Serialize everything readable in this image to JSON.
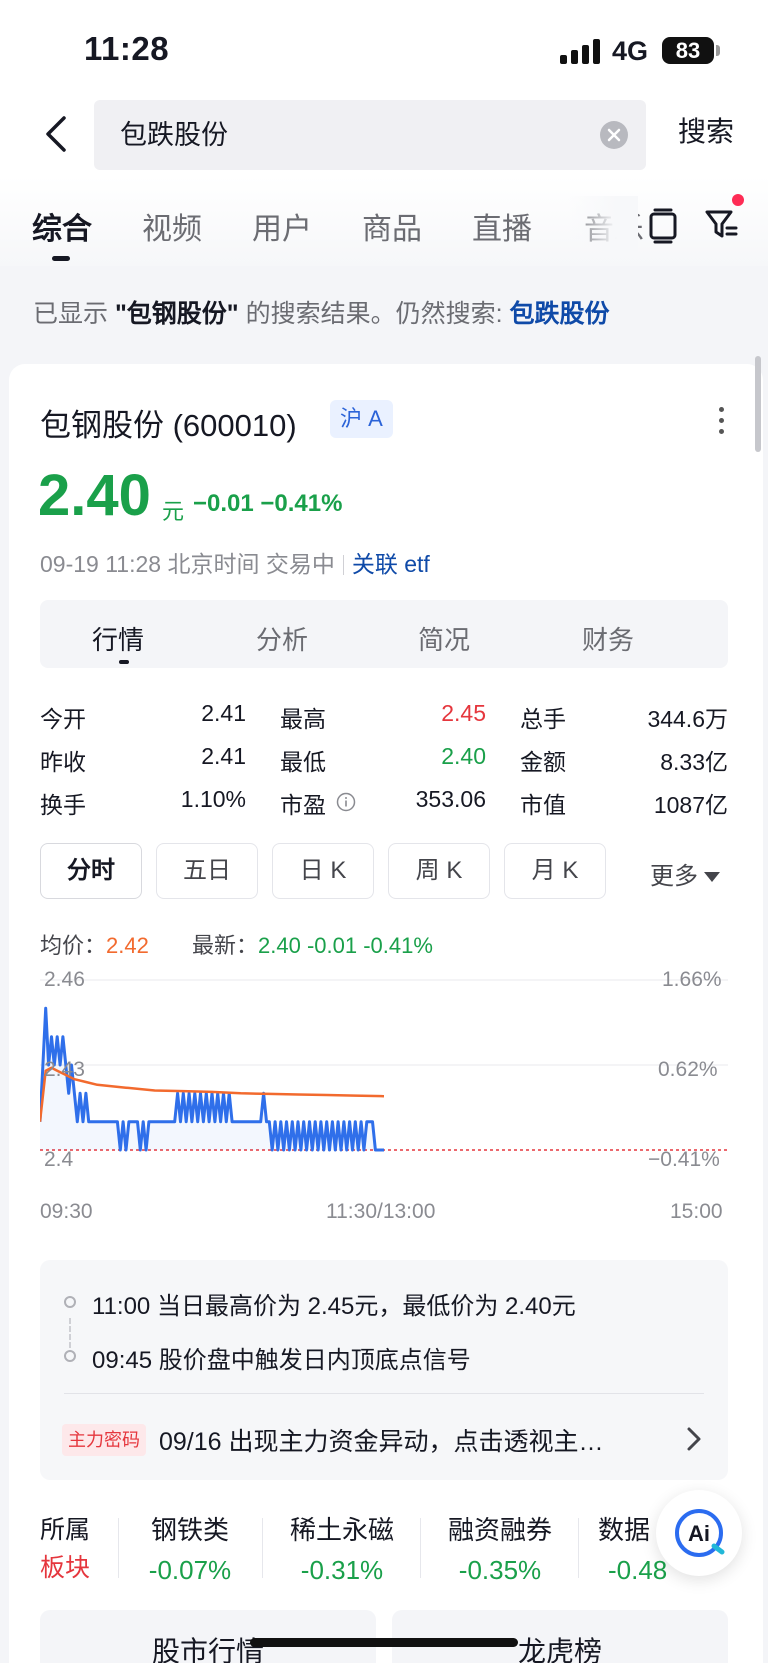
{
  "status_bar": {
    "time": "11:28",
    "network": "4G",
    "battery": "83"
  },
  "search": {
    "query": "包跌股份",
    "button_label": "搜索"
  },
  "tabs": [
    {
      "label": "综合",
      "active": true
    },
    {
      "label": "视频"
    },
    {
      "label": "用户"
    },
    {
      "label": "商品"
    },
    {
      "label": "直播"
    },
    {
      "label": "音乐"
    }
  ],
  "notice": {
    "prefix": "已显示 ",
    "shown_term": "\"包钢股份\"",
    "middle": " 的搜索结果。仍然搜索: ",
    "original_term": "包跌股份"
  },
  "stock": {
    "name": "包钢股份 (600010)",
    "market": "沪 A",
    "price": "2.40",
    "unit": "元",
    "change": "−0.01 −0.41%",
    "datetime": "09-19 11:28 北京时间 交易中",
    "etf_link": "关联 etf"
  },
  "subtabs": [
    "行情",
    "分析",
    "简况",
    "财务"
  ],
  "stats": {
    "open_label": "今开",
    "open": "2.41",
    "high_label": "最高",
    "high": "2.45",
    "volume_label": "总手",
    "volume": "344.6万",
    "prev_close_label": "昨收",
    "prev_close": "2.41",
    "low_label": "最低",
    "low": "2.40",
    "amount_label": "金额",
    "amount": "8.33亿",
    "turnover_label": "换手",
    "turnover": "1.10%",
    "pe_label": "市盈",
    "pe": "353.06",
    "market_cap_label": "市值",
    "market_cap": "1087亿"
  },
  "periods": [
    "分时",
    "五日",
    "日 K",
    "周 K",
    "月 K"
  ],
  "more_label": "更多",
  "legend": {
    "avg_label": "均价：",
    "avg_value": "2.42",
    "latest_label": "最新：",
    "latest_value": "2.40 -0.01 -0.41%"
  },
  "chart_data": {
    "type": "line",
    "y_ticks": [
      "2.46",
      "2.43",
      "2.4"
    ],
    "y_right_ticks": [
      "1.66%",
      "0.62%",
      "−0.41%"
    ],
    "x_ticks": [
      "09:30",
      "11:30/13:00",
      "15:00"
    ],
    "ylim": [
      2.4,
      2.46
    ],
    "prev_close": 2.41,
    "series": [
      {
        "color": "#2f6fea",
        "x": [
          0,
          1,
          2,
          3,
          4,
          5,
          6,
          7,
          8,
          9,
          10,
          11,
          12,
          13,
          14,
          15,
          16,
          17,
          18,
          19,
          20,
          21,
          22,
          23,
          24,
          25,
          26,
          27,
          28,
          29,
          30,
          31,
          32,
          33,
          34,
          35,
          36,
          37,
          38,
          39,
          40,
          41,
          42,
          43,
          44,
          45,
          46,
          47,
          48,
          49,
          50,
          51,
          52,
          53,
          54,
          55,
          56,
          57,
          58,
          59,
          60,
          61,
          62,
          63,
          64,
          65,
          66,
          67,
          68,
          69,
          70,
          71,
          72,
          73,
          74,
          75,
          76,
          77,
          78,
          79,
          80,
          81,
          82,
          83,
          84,
          85,
          86,
          87,
          88,
          89,
          90,
          91,
          92,
          93,
          94,
          95,
          96,
          97,
          98,
          99,
          100,
          101,
          102,
          103,
          104,
          105,
          106,
          107,
          108,
          109,
          110,
          111,
          112,
          113,
          114,
          115,
          116,
          117,
          118,
          119,
          120
        ],
        "values": [
          2.41,
          2.43,
          2.45,
          2.43,
          2.44,
          2.43,
          2.44,
          2.43,
          2.44,
          2.43,
          2.42,
          2.43,
          2.42,
          2.41,
          2.42,
          2.41,
          2.42,
          2.41,
          2.41,
          2.41,
          2.41,
          2.41,
          2.41,
          2.41,
          2.41,
          2.41,
          2.41,
          2.41,
          2.4,
          2.41,
          2.4,
          2.41,
          2.41,
          2.41,
          2.41,
          2.4,
          2.41,
          2.4,
          2.41,
          2.41,
          2.41,
          2.41,
          2.41,
          2.41,
          2.41,
          2.41,
          2.41,
          2.41,
          2.42,
          2.41,
          2.42,
          2.41,
          2.42,
          2.41,
          2.42,
          2.41,
          2.42,
          2.41,
          2.42,
          2.41,
          2.42,
          2.41,
          2.42,
          2.41,
          2.42,
          2.41,
          2.42,
          2.41,
          2.41,
          2.41,
          2.41,
          2.41,
          2.41,
          2.41,
          2.41,
          2.41,
          2.41,
          2.41,
          2.42,
          2.41,
          2.41,
          2.4,
          2.41,
          2.4,
          2.41,
          2.4,
          2.41,
          2.4,
          2.41,
          2.4,
          2.41,
          2.4,
          2.41,
          2.4,
          2.41,
          2.4,
          2.41,
          2.4,
          2.41,
          2.4,
          2.41,
          2.4,
          2.41,
          2.4,
          2.41,
          2.4,
          2.41,
          2.4,
          2.41,
          2.4,
          2.41,
          2.4,
          2.41,
          2.4,
          2.41,
          2.41,
          2.41,
          2.4,
          2.4,
          2.4,
          2.4
        ]
      },
      {
        "color": "#f26a2e",
        "x": [
          0,
          2,
          4,
          6,
          8,
          12,
          16,
          20,
          30,
          40,
          50,
          60,
          70,
          80,
          90,
          100,
          110,
          120
        ],
        "values": [
          2.41,
          2.428,
          2.429,
          2.428,
          2.427,
          2.425,
          2.424,
          2.423,
          2.422,
          2.421,
          2.4208,
          2.4205,
          2.42,
          2.4198,
          2.4196,
          2.4194,
          2.4192,
          2.419
        ]
      }
    ],
    "x_total": 240
  },
  "events": [
    "11:00 当日最高价为 2.45元，最低价为 2.40元",
    "09:45 股价盘中触发日内顶底点信号"
  ],
  "fund_alert": {
    "tag": "主力密码",
    "text": "09/16 出现主力资金异动，点击透视主…"
  },
  "sectors": {
    "label_top": "所属",
    "label_bottom": "板块",
    "items": [
      {
        "name": "钢铁类",
        "change": "-0.07%"
      },
      {
        "name": "稀土永磁",
        "change": "-0.31%"
      },
      {
        "name": "融资融券",
        "change": "-0.35%"
      },
      {
        "name": "数据",
        "change": "-0.48"
      }
    ]
  },
  "bottom_buttons": [
    "股市行情",
    "龙虎榜"
  ],
  "colors": {
    "up": "#e5363d",
    "down": "#1aa04a",
    "link": "#0f4aa8",
    "avg_line": "#f26a2e",
    "price_line": "#2f6fea"
  }
}
